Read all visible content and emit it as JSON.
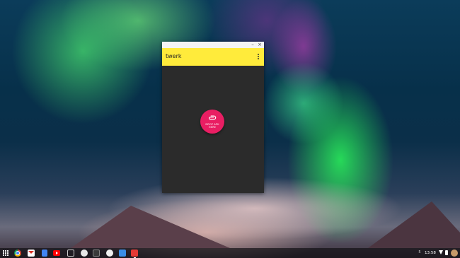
{
  "window": {
    "minimize_glyph": "–",
    "close_glyph": "×"
  },
  "app": {
    "title": "twerk",
    "drop_label": "DROP APK\nHERE",
    "accent_color": "#ffeb3b",
    "button_color": "#e91e63"
  },
  "shelf": {
    "apps": [
      {
        "name": "chrome-icon"
      },
      {
        "name": "gmail-icon"
      },
      {
        "name": "docs-icon"
      },
      {
        "name": "youtube-icon"
      },
      {
        "name": "files-icon"
      },
      {
        "name": "google-icon"
      },
      {
        "name": "stocks-icon"
      },
      {
        "name": "hangouts-icon"
      },
      {
        "name": "twerk-app-icon"
      },
      {
        "name": "android-app-icon"
      }
    ],
    "notification_count": "5",
    "clock": "13:58"
  }
}
